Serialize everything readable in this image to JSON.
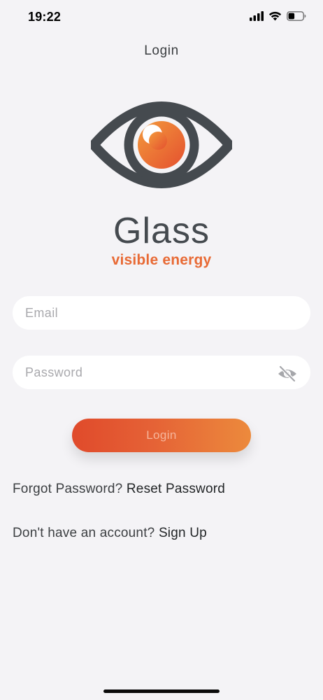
{
  "status_bar": {
    "time": "19:22"
  },
  "header": {
    "title": "Login"
  },
  "brand": {
    "name": "Glass",
    "tagline": "visible energy"
  },
  "form": {
    "email_placeholder": "Email",
    "email_value": "",
    "password_placeholder": "Password",
    "password_value": "",
    "login_label": "Login"
  },
  "links": {
    "forgot_prompt": "Forgot Password?",
    "reset_label": "Reset Password",
    "signup_prompt": "Don't have an account?",
    "signup_label": "Sign Up"
  },
  "icons": {
    "signal": "cellular-signal-icon",
    "wifi": "wifi-icon",
    "battery": "battery-icon",
    "logo": "eye-logo-icon",
    "password_toggle": "eye-slash-icon"
  },
  "colors": {
    "background": "#f4f3f6",
    "brand_dark": "#454a4f",
    "brand_accent": "#e86a35",
    "button_start": "#e04a2b",
    "button_end": "#ec8a3c"
  }
}
